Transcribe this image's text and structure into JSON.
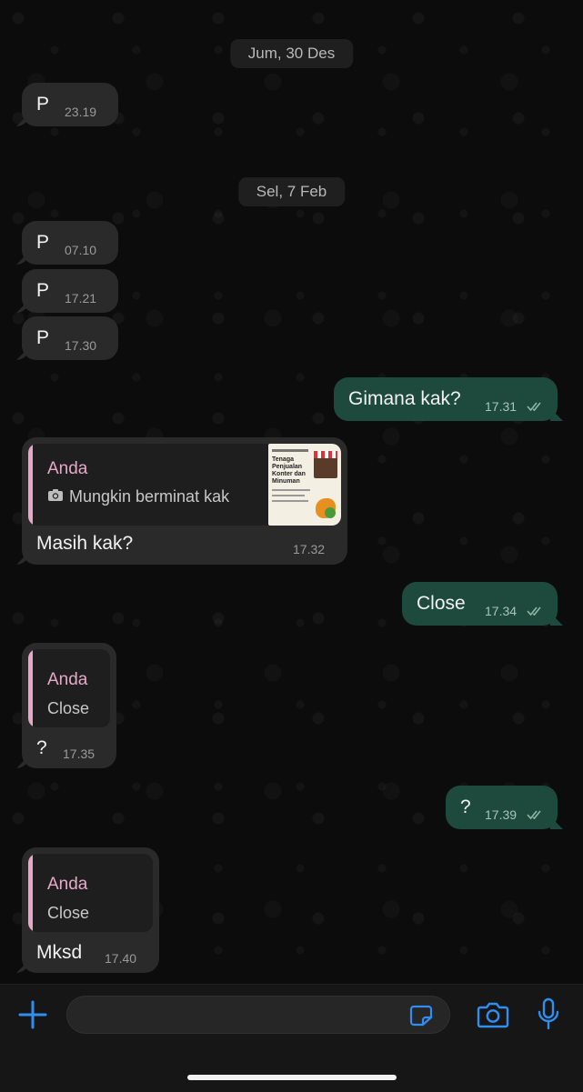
{
  "dates": {
    "d1": "Jum, 30 Des",
    "d2": "Sel, 7 Feb"
  },
  "messages": {
    "m1": {
      "text": "P",
      "time": "23.19"
    },
    "m2": {
      "text": "P",
      "time": "07.10"
    },
    "m3": {
      "text": "P",
      "time": "17.21"
    },
    "m4": {
      "text": "P",
      "time": "17.30"
    },
    "m5": {
      "text": "Gimana kak?",
      "time": "17.31"
    },
    "m6": {
      "quote_author": "Anda",
      "quote_text": "Mungkin berminat kak",
      "text": "Masih kak?",
      "time": "17.32"
    },
    "m7": {
      "text": "Close",
      "time": "17.34"
    },
    "m8": {
      "quote_author": "Anda",
      "quote_text": "Close",
      "text": "?",
      "time": "17.35"
    },
    "m9": {
      "text": "?",
      "time": "17.39"
    },
    "m10": {
      "quote_author": "Anda",
      "quote_text": "Close",
      "text": "Mksd",
      "time": "17.40"
    }
  },
  "thumbnail": {
    "title": "Tenaga Penjualan Konter dan Minuman"
  },
  "icons": {
    "attach": "plus-icon",
    "sticker": "sticker-icon",
    "camera": "camera-icon",
    "mic": "microphone-icon",
    "photo": "camera-small-icon",
    "read": "double-check-icon"
  },
  "colors": {
    "accent": "#2f8ef0",
    "outgoing": "#1d4a3c",
    "incoming": "#2a2a2a",
    "quote_author": "#e7a8c8"
  }
}
